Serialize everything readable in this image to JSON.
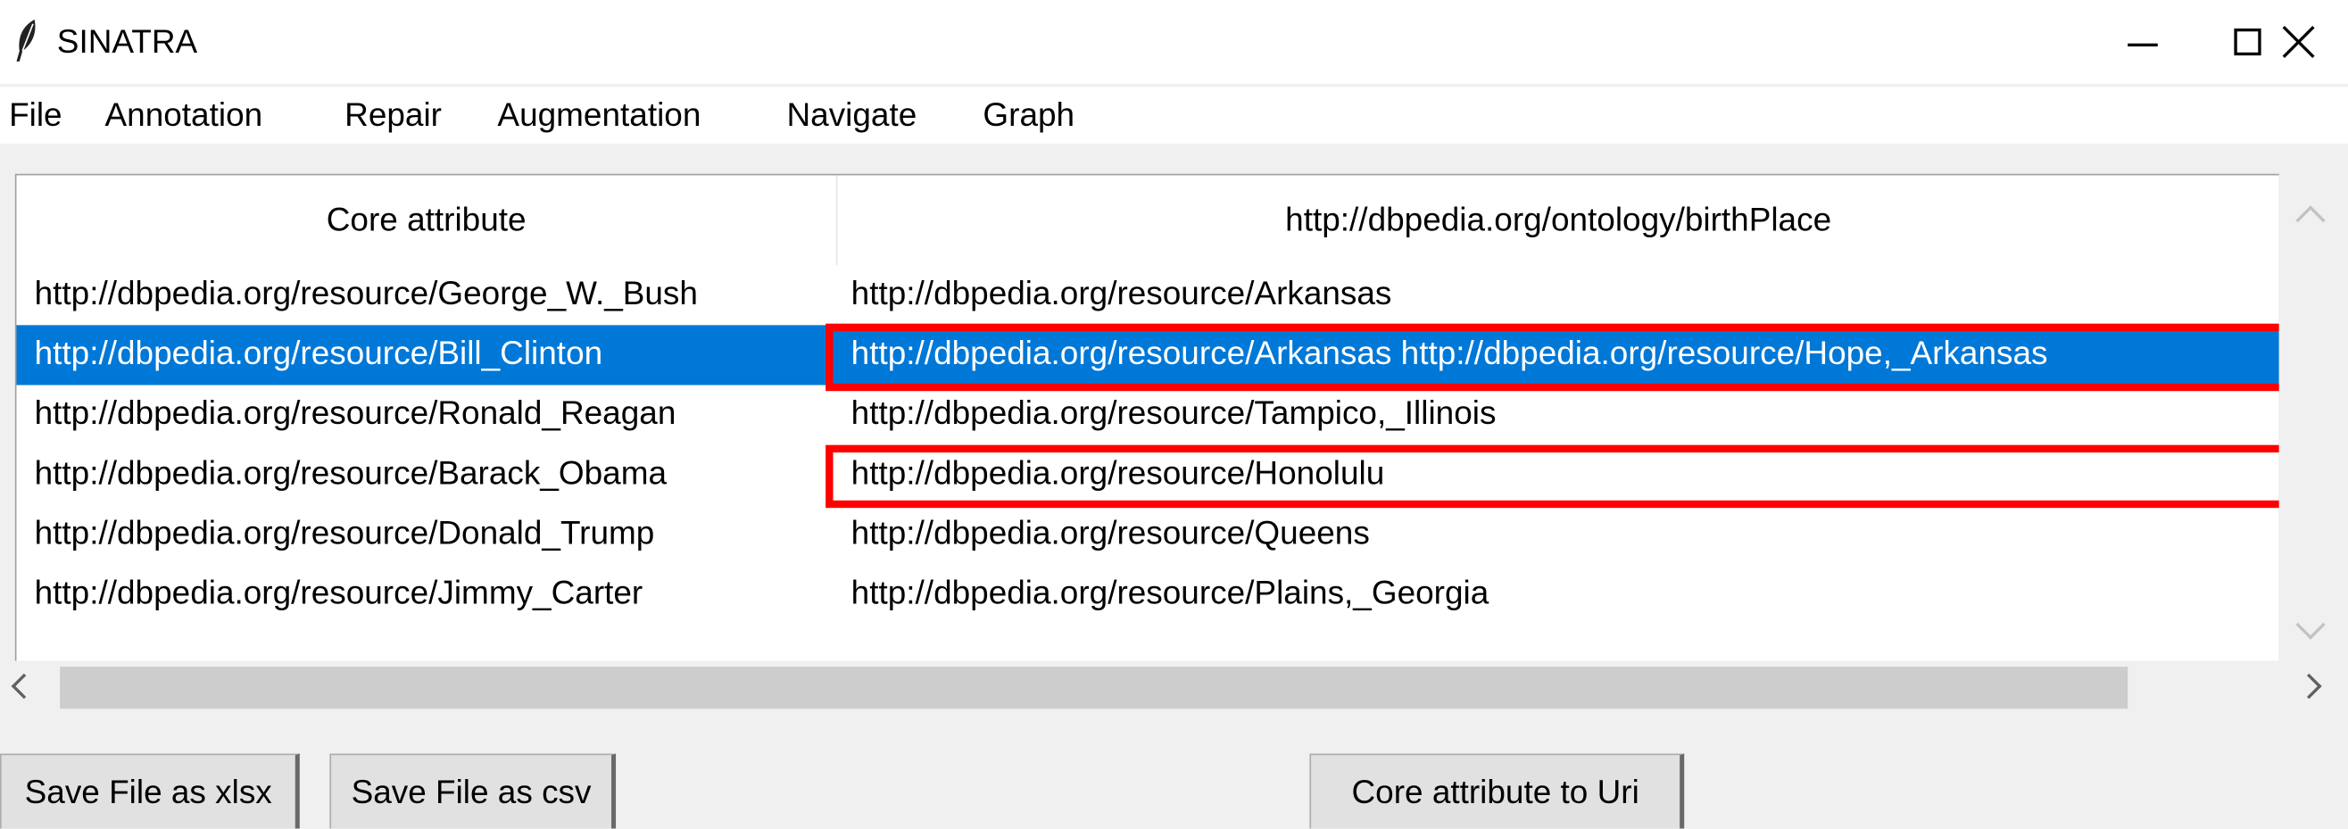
{
  "window": {
    "title": "SINATRA",
    "icon": "feather-icon"
  },
  "menu": [
    "File",
    "Annotation",
    "Repair",
    "Augmentation",
    "Navigate",
    "Graph"
  ],
  "table": {
    "columns": [
      "Core attribute",
      "http://dbpedia.org/ontology/birthPlace"
    ],
    "rows": [
      [
        "http://dbpedia.org/resource/George_W._Bush",
        "http://dbpedia.org/resource/Arkansas"
      ],
      [
        "http://dbpedia.org/resource/Bill_Clinton",
        "http://dbpedia.org/resource/Arkansas http://dbpedia.org/resource/Hope,_Arkansas"
      ],
      [
        "http://dbpedia.org/resource/Ronald_Reagan",
        "http://dbpedia.org/resource/Tampico,_Illinois"
      ],
      [
        "http://dbpedia.org/resource/Barack_Obama",
        "http://dbpedia.org/resource/Honolulu"
      ],
      [
        "http://dbpedia.org/resource/Donald_Trump",
        "http://dbpedia.org/resource/Queens"
      ],
      [
        "http://dbpedia.org/resource/Jimmy_Carter",
        "http://dbpedia.org/resource/Plains,_Georgia"
      ]
    ],
    "selected_row": 1,
    "highlight_color": "#ff0000",
    "selection_color": "#0078d7"
  },
  "buttons": {
    "save_xlsx": "Save File as xlsx",
    "save_csv": "Save File as csv",
    "core_to_uri": "Core attribute to Uri"
  }
}
